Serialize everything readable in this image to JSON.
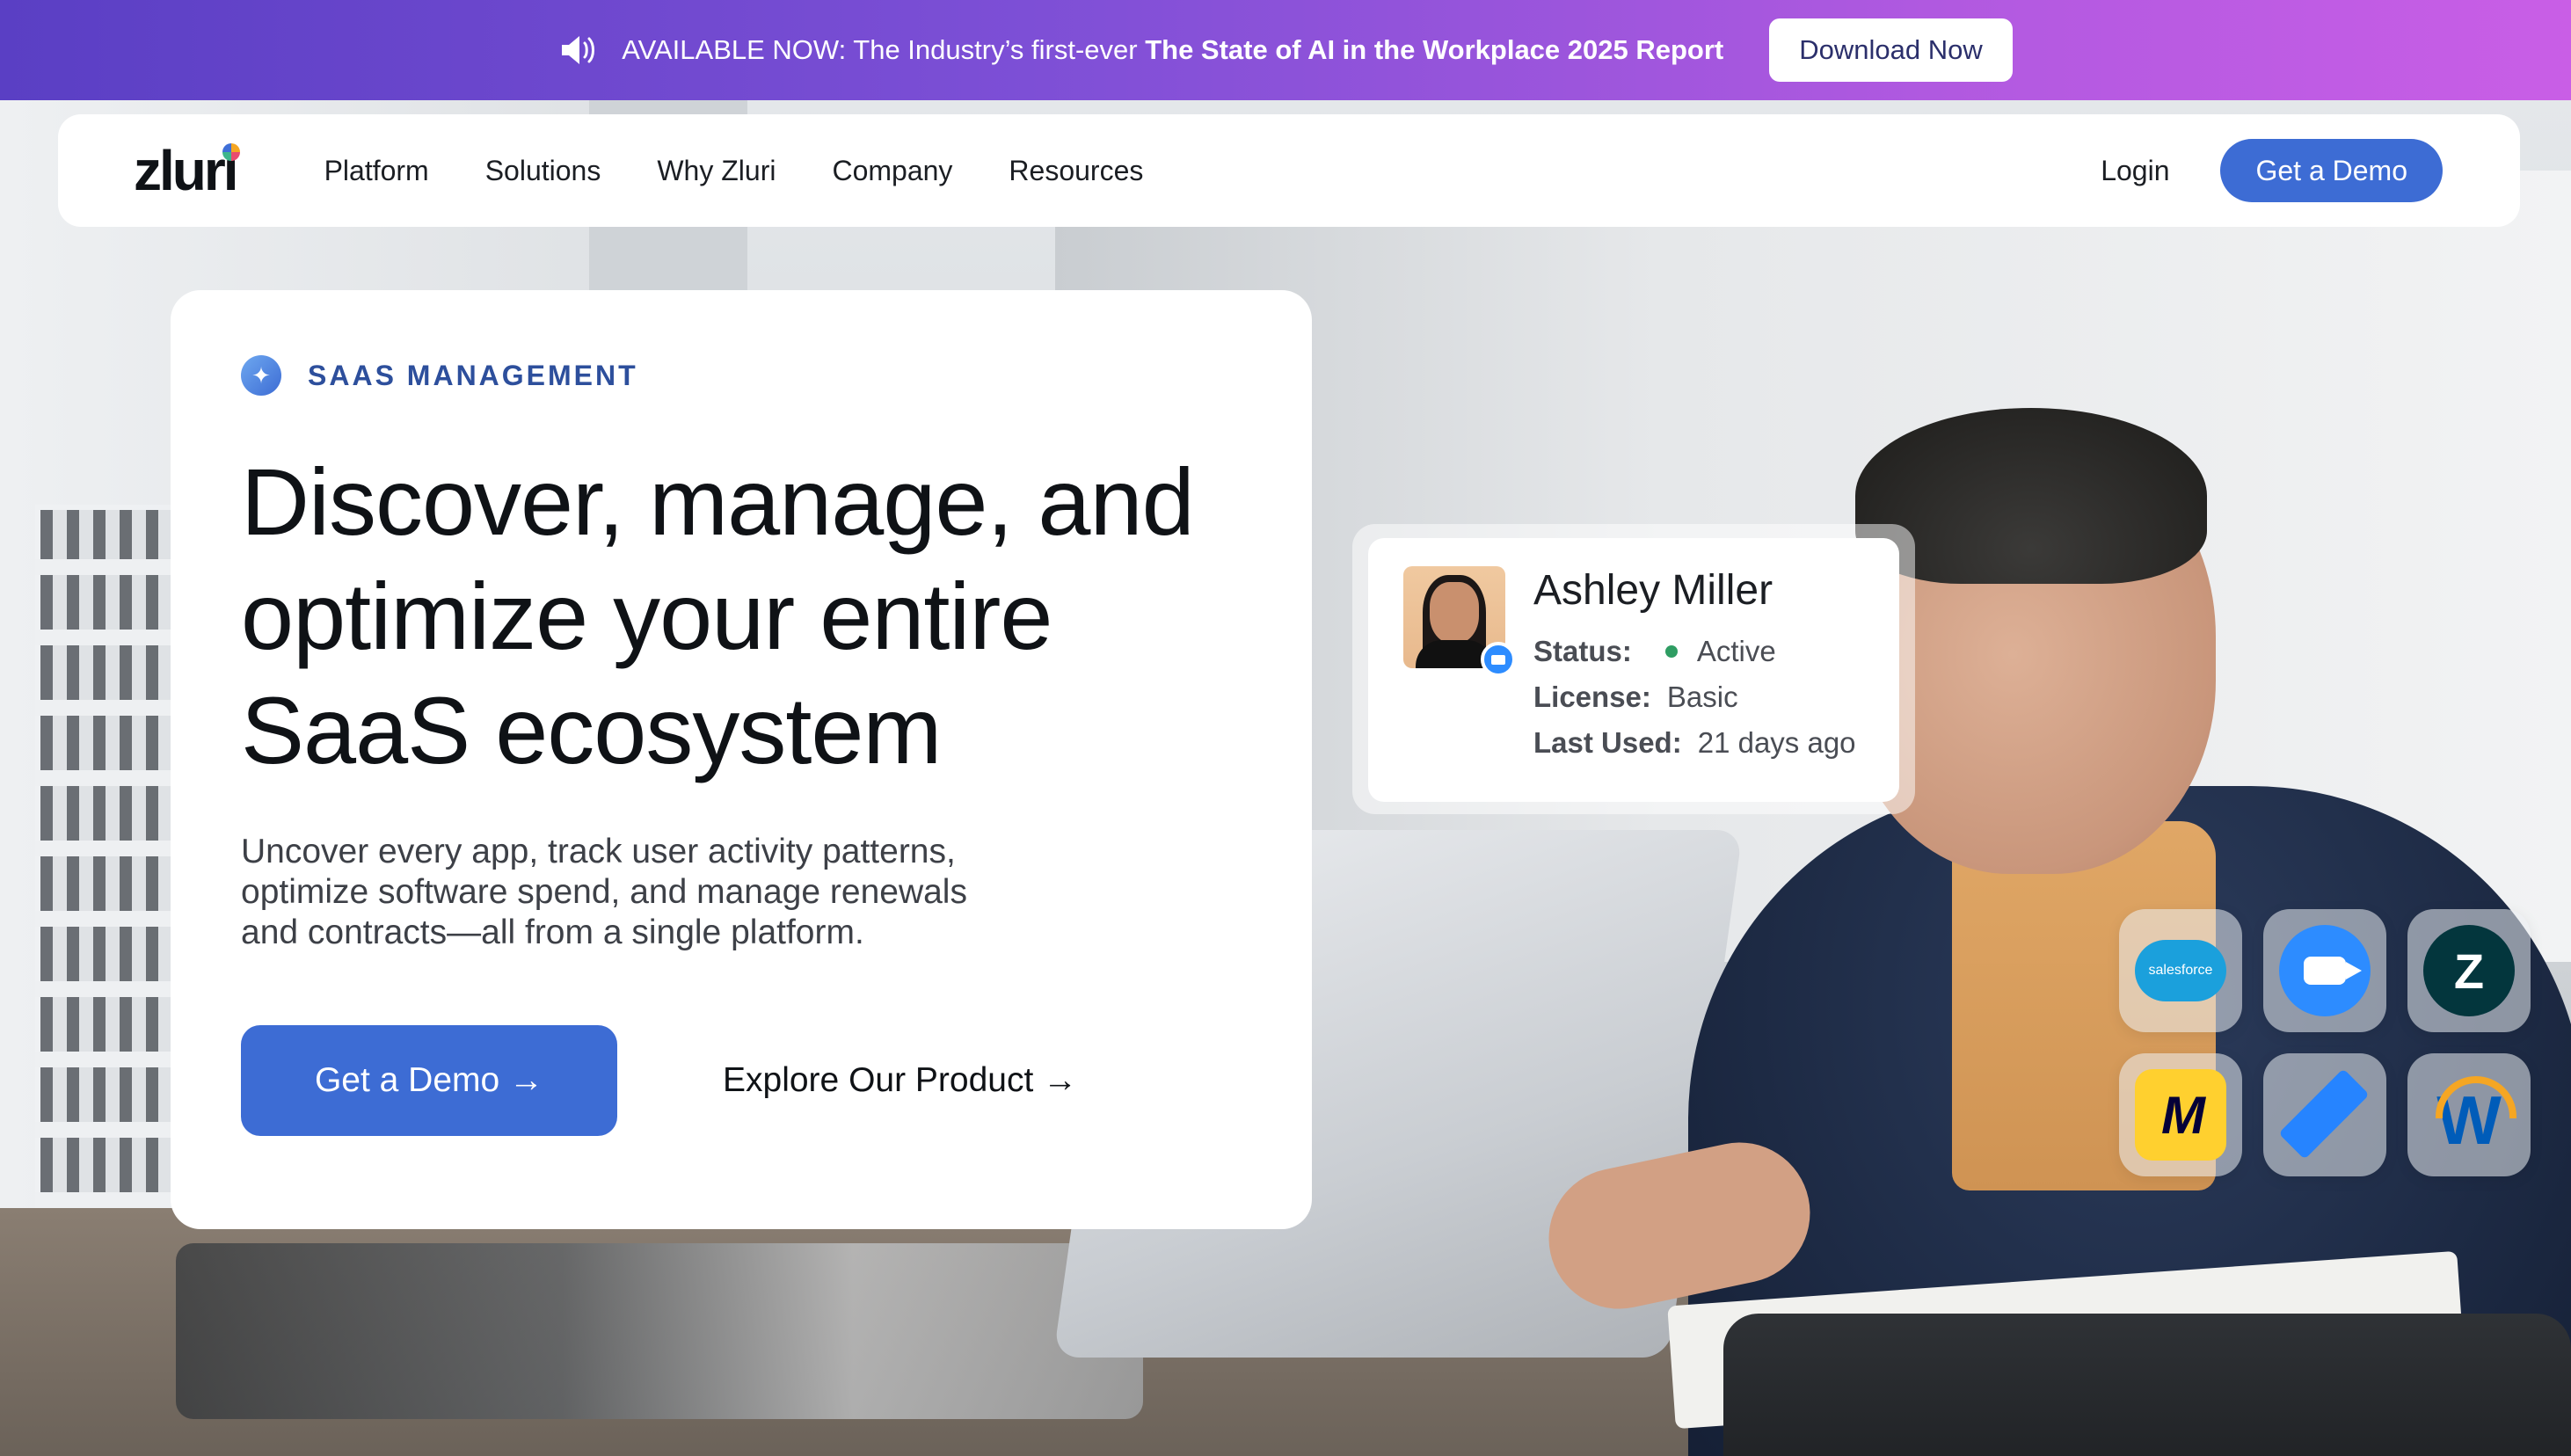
{
  "announcement": {
    "prefix": "AVAILABLE NOW: The Industry’s first-ever",
    "highlight": "The State of AI in the Workplace 2025 Report",
    "button": "Download Now",
    "icon": "speaker-icon"
  },
  "nav": {
    "logo": "zluri",
    "links": [
      "Platform",
      "Solutions",
      "Why Zluri",
      "Company",
      "Resources"
    ],
    "login": "Login",
    "cta": "Get a Demo"
  },
  "hero": {
    "eyebrow": "SAAS MANAGEMENT",
    "headline_lines": [
      "Discover, manage, and",
      "optimize your entire",
      "SaaS ecosystem"
    ],
    "subhead_lines": [
      "Uncover every app, track user activity patterns,",
      "optimize software spend, and manage renewals",
      "and contracts—all from a single platform."
    ],
    "primary_cta": "Get a Demo →",
    "secondary_cta": "Explore Our Product →"
  },
  "profile": {
    "name": "Ashley Miller",
    "status_label": "Status:",
    "status_value": "Active",
    "license_label": "License:",
    "license_value": "Basic",
    "last_used_label": "Last Used:",
    "last_used_value": "21 days ago",
    "status_color": "#2f9d63"
  },
  "apps": [
    {
      "name": "salesforce",
      "label": "salesforce",
      "color": "#1ba0dc"
    },
    {
      "name": "zoom",
      "color": "#2d8cff"
    },
    {
      "name": "zendesk",
      "color": "#03363d"
    },
    {
      "name": "miro",
      "color": "#ffd02f"
    },
    {
      "name": "jira",
      "color": "#2684ff"
    },
    {
      "name": "workday",
      "color": "#005cb9"
    }
  ],
  "colors": {
    "accent": "#3d6cd4",
    "announce_gradient_start": "#5a3fc4",
    "announce_gradient_end": "#c95ee6"
  }
}
